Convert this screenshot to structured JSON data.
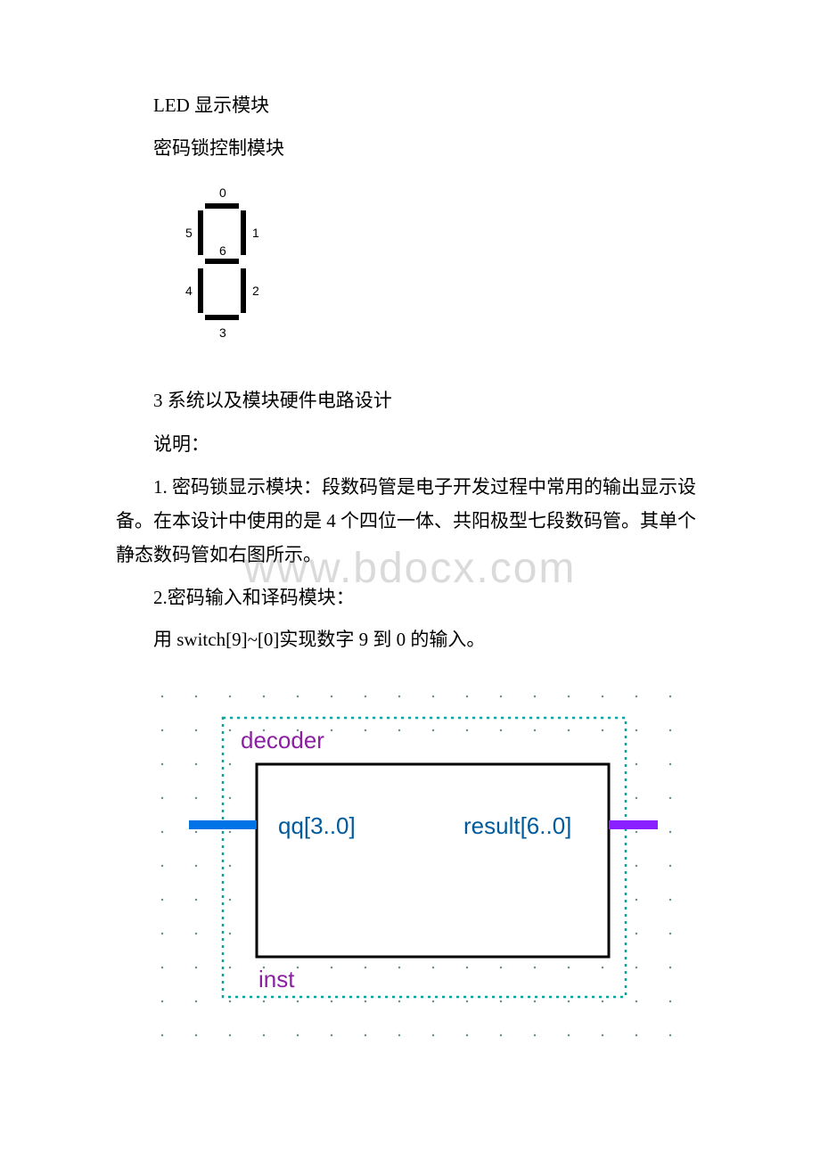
{
  "lines": {
    "l1": "LED 显示模块",
    "l2": "密码锁控制模块",
    "l3": "3 系统以及模块硬件电路设计",
    "l4": "说明：",
    "l5": "1. 密码锁显示模块：段数码管是电子开发过程中常用的输出显示设备。在本设计中使用的是 4 个四位一体、共阳极型七段数码管。其单个静态数码管如右图所示。",
    "l6": "2.密码输入和译码模块：",
    "l7": " 用 switch[9]~[0]实现数字 9 到 0 的输入。"
  },
  "seven_seg": {
    "labels": {
      "top": "0",
      "tr": "1",
      "br": "2",
      "bottom": "3",
      "bl": "4",
      "tl": "5",
      "mid": "6"
    }
  },
  "decoder": {
    "title": "decoder",
    "in_label": "qq[3..0]",
    "out_label": "result[6..0]",
    "inst": "inst"
  },
  "watermark": "www.bdocx.com"
}
